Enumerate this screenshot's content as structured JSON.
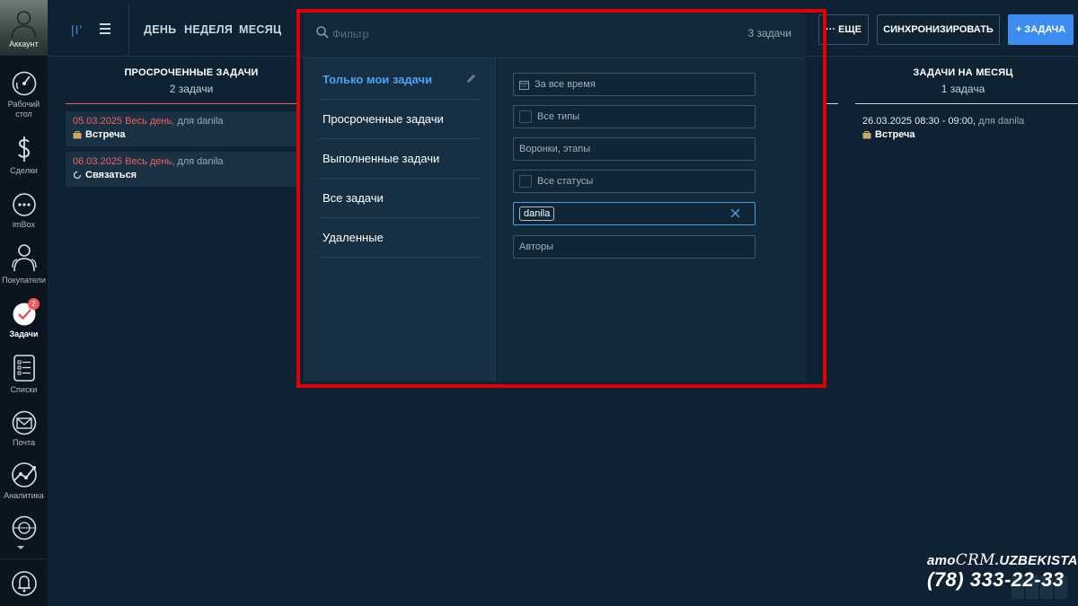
{
  "sidebar": {
    "account": {
      "label": "Аккаунт"
    },
    "items": [
      {
        "name": "dashboard",
        "label": "Рабочий стол",
        "icon": "speedometer-icon"
      },
      {
        "name": "deals",
        "label": "Сделки",
        "icon": "dollar-icon"
      },
      {
        "name": "imbox",
        "label": "imBox",
        "icon": "chat-bubble-icon"
      },
      {
        "name": "customers",
        "label": "Покупатели",
        "icon": "people-icon"
      },
      {
        "name": "tasks",
        "label": "Задачи",
        "icon": "checkmark-circle-icon",
        "badge": "2",
        "active": true
      },
      {
        "name": "lists",
        "label": "Списки",
        "icon": "list-icon"
      },
      {
        "name": "mail",
        "label": "Почта",
        "icon": "envelope-icon"
      },
      {
        "name": "analytics",
        "label": "Аналитика",
        "icon": "chart-line-icon"
      }
    ]
  },
  "toolbar": {
    "periods": [
      "ДЕНЬ",
      "НЕДЕЛЯ",
      "МЕСЯЦ"
    ],
    "more_label": "··· ЕЩЕ",
    "sync_label": "СИНХРОНИЗИРОВАТЬ",
    "add_label": "+ ЗАДАЧА"
  },
  "filter": {
    "search_placeholder": "Фильтр",
    "count_label": "3 задачи",
    "presets": [
      {
        "label": "Только мои задачи",
        "active": true
      },
      {
        "label": "Просроченные задачи"
      },
      {
        "label": "Выполненные задачи"
      },
      {
        "label": "Все задачи"
      },
      {
        "label": "Удаленные"
      }
    ],
    "fields": {
      "period": "За все время",
      "types": "Все типы",
      "pipelines": "Воронки, этапы",
      "statuses": "Все статусы",
      "responsible_tag": "danila",
      "authors": "Авторы"
    }
  },
  "columns": {
    "overdue": {
      "title": "ПРОСРОЧЕННЫЕ ЗАДАЧИ",
      "count": "2 задачи",
      "tasks": [
        {
          "date": "05.03.2025 Весь день,",
          "for": "для danila",
          "type": "Встреча"
        },
        {
          "date": "06.03.2025 Весь день,",
          "for": "для danila",
          "type": "Связаться"
        }
      ]
    },
    "month": {
      "title": "ЗАДАЧИ НА МЕСЯЦ",
      "count": "1 задача",
      "tasks": [
        {
          "date": "26.03.2025 08:30 - 09:00,",
          "for": "для danila",
          "type": "Встреча"
        }
      ]
    }
  },
  "watermark": {
    "brand_amo": "amo",
    "brand_crm": "CRM",
    "brand_suffix": ".UZBEKISTAN",
    "phone": "(78) 333-22-33"
  },
  "colors": {
    "accent": "#3d8cf2",
    "overdue": "#f06060",
    "highlight_border": "#e30000"
  }
}
